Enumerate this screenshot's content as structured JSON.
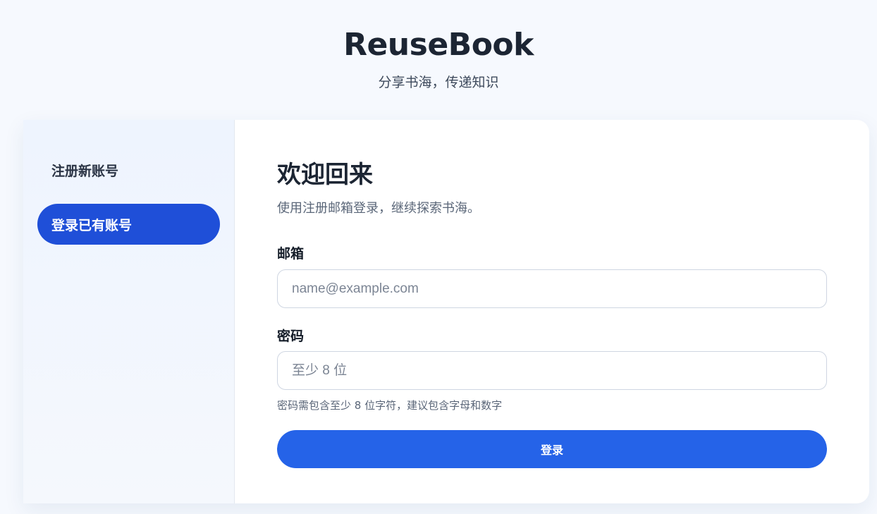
{
  "brand": {
    "title": "ReuseBook",
    "tagline": "分享书海，传递知识"
  },
  "sidebar": {
    "items": [
      {
        "label": "注册新账号",
        "active": false
      },
      {
        "label": "登录已有账号",
        "active": true
      }
    ]
  },
  "form": {
    "title": "欢迎回来",
    "subtitle": "使用注册邮箱登录，继续探索书海。",
    "email": {
      "label": "邮箱",
      "placeholder": "name@example.com",
      "value": ""
    },
    "password": {
      "label": "密码",
      "placeholder": "至少 8 位",
      "value": ""
    },
    "hint": "密码需包含至少 8 位字符，建议包含字母和数字",
    "submit_label": "登录"
  },
  "colors": {
    "accent": "#2563e8",
    "active_nav": "#1f4fd8",
    "page_background": "#f6f9fe"
  }
}
